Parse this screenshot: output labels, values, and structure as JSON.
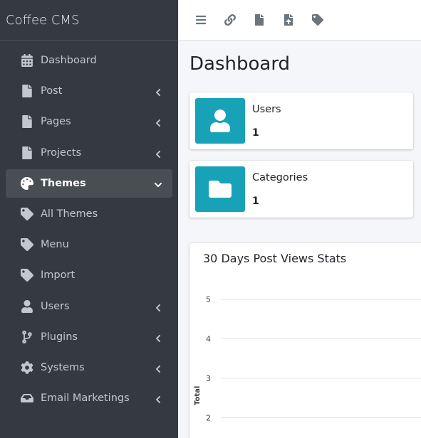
{
  "brand": {
    "name": "Coffee CMS"
  },
  "sidebar": {
    "items": [
      {
        "label": "Dashboard",
        "icon": "calendar-icon",
        "chevron": ""
      },
      {
        "label": "Post",
        "icon": "file-icon",
        "chevron": "left"
      },
      {
        "label": "Pages",
        "icon": "file-icon",
        "chevron": "left"
      },
      {
        "label": "Projects",
        "icon": "file-icon",
        "chevron": "left"
      },
      {
        "label": "Themes",
        "icon": "palette-icon",
        "chevron": "down",
        "active": true
      },
      {
        "label": "All Themes",
        "icon": "tag-icon",
        "chevron": ""
      },
      {
        "label": "Menu",
        "icon": "tag-icon",
        "chevron": ""
      },
      {
        "label": "Import",
        "icon": "tag-icon",
        "chevron": ""
      },
      {
        "label": "Users",
        "icon": "user-icon",
        "chevron": "left"
      },
      {
        "label": "Plugins",
        "icon": "branch-icon",
        "chevron": "left"
      },
      {
        "label": "Systems",
        "icon": "cog-icon",
        "chevron": "left"
      },
      {
        "label": "Email Marketings",
        "icon": "inbox-icon",
        "chevron": "left"
      }
    ]
  },
  "topbar": {
    "icons": [
      "menu-icon",
      "link-icon",
      "file-icon",
      "file-upload-icon",
      "tag-icon"
    ]
  },
  "main": {
    "title": "Dashboard",
    "info_boxes": [
      {
        "label": "Users",
        "value": "1",
        "icon": "user-icon",
        "color": "#17a2b8"
      },
      {
        "label": "Categories",
        "value": "1",
        "icon": "folder-icon",
        "color": "#17a2b8"
      }
    ]
  },
  "chart_data": {
    "type": "line",
    "title": "30 Days Post Views Stats",
    "ylabel": "Total",
    "yticks": [
      "5",
      "4",
      "3",
      "2"
    ],
    "grid": true
  },
  "colors": {
    "sidebar_bg": "#343a40",
    "accent": "#17a2b8",
    "active_item": "#494e53"
  }
}
